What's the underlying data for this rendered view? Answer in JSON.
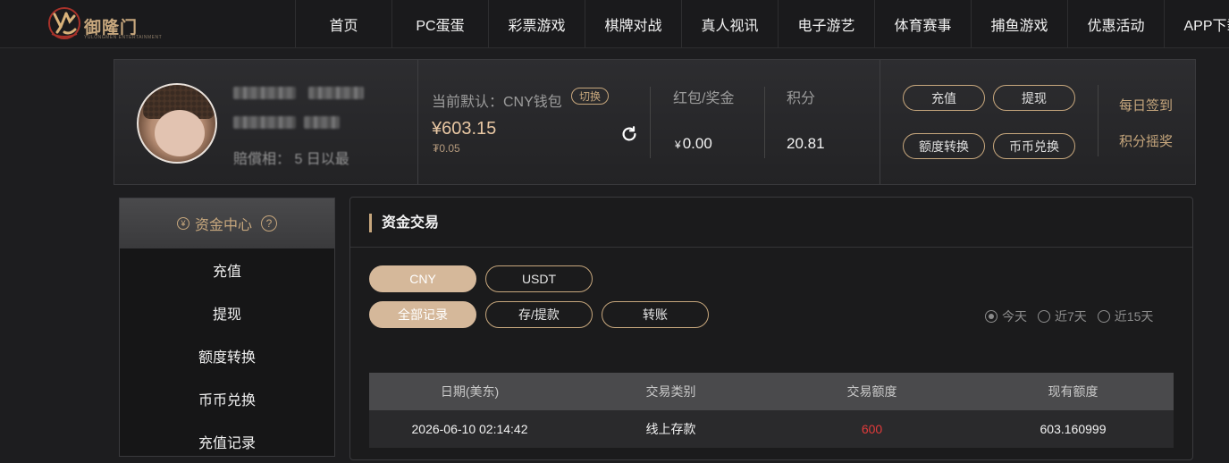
{
  "logo": {
    "brand": "御隆门",
    "sub": "YULONGMEN ENTERTAINMENT"
  },
  "nav": [
    "首页",
    "PC蛋蛋",
    "彩票游戏",
    "棋牌对战",
    "真人视讯",
    "电子游艺",
    "体育赛事",
    "捕鱼游戏",
    "优惠活动",
    "APP下载"
  ],
  "profile": {
    "user_line3": "賠償相：  5 日以最",
    "wallet_label": "当前默认：CNY钱包",
    "switch_label": "切换",
    "balance": "¥603.15",
    "balance_sub": "₮0.05",
    "bonus_label": "红包/奖金",
    "bonus_currency": "¥",
    "bonus_value": "0.00",
    "points_label": "积分",
    "points_value": "20.81",
    "actions": [
      "充值",
      "提现",
      "额度转换",
      "币币兑换"
    ],
    "links": [
      "每日签到",
      "积分摇奖"
    ]
  },
  "sidebar": {
    "title": "资金中心",
    "coin_symbol": "¥",
    "help": "?",
    "items": [
      "充值",
      "提现",
      "额度转换",
      "币币兑换",
      "充值记录"
    ]
  },
  "panel": {
    "title": "资金交易",
    "currency_tabs": [
      "CNY",
      "USDT"
    ],
    "record_tabs": [
      "全部记录",
      "存/提款",
      "转账"
    ],
    "ranges": [
      "今天",
      "近7天",
      "近15天"
    ],
    "table": {
      "headers": [
        "日期(美东)",
        "交易类别",
        "交易额度",
        "现有额度"
      ],
      "rows": [
        [
          "2026-06-10 02:14:42",
          "线上存款",
          "600",
          "603.160999"
        ]
      ]
    }
  },
  "colors": {
    "accent": "#c7a77d",
    "active_pill": "#d5b89a",
    "amount": "#e23b3b"
  }
}
